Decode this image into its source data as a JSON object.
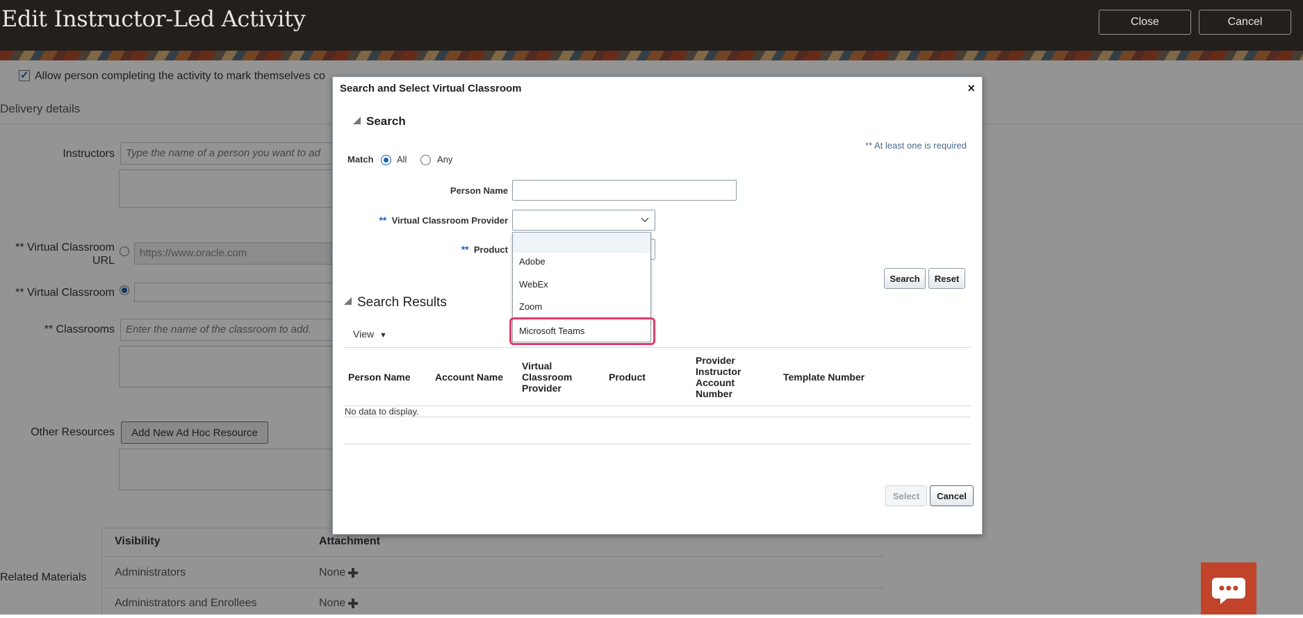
{
  "header": {
    "title": "Edit Instructor-Led Activity",
    "close_label": "Close",
    "cancel_label": "Cancel"
  },
  "page": {
    "allow_mark_complete_label": "Allow person completing the activity to mark themselves co",
    "allow_mark_complete_checked": true,
    "delivery_details_heading": "Delivery details",
    "instructors_label": "Instructors",
    "instructors_placeholder": "Type the name of a person you want to ad",
    "virtual_classroom_url_label_line1": "** Virtual Classroom",
    "virtual_classroom_url_label_line2": "URL",
    "virtual_classroom_url_placeholder": "https://www.oracle.com",
    "virtual_classroom_label": "** Virtual Classroom",
    "classrooms_label": "** Classrooms",
    "classrooms_placeholder": "Enter the name of the classroom to add.",
    "other_resources_label": "Other Resources",
    "add_ad_hoc_resource_label": "Add New Ad Hoc Resource",
    "related_materials_label": "Related Materials",
    "materials_table": {
      "headers": [
        "Visibility",
        "Attachment"
      ],
      "rows": [
        {
          "visibility": "Administrators",
          "attachment": "None"
        },
        {
          "visibility": "Administrators and Enrollees",
          "attachment": "None"
        }
      ]
    }
  },
  "dialog": {
    "title": "Search and Select Virtual Classroom",
    "close_symbol": "×",
    "search_heading": "Search",
    "required_note": "** At least one is required",
    "match_label": "Match",
    "match_options": [
      "All",
      "Any"
    ],
    "match_selected": "All",
    "person_name_label": "Person Name",
    "person_name_value": "",
    "provider_required_marker": "**",
    "provider_label": "Virtual Classroom Provider",
    "provider_value": "",
    "product_required_marker": "**",
    "product_label": "Product",
    "provider_options": [
      "",
      "Adobe",
      "WebEx",
      "Zoom",
      "Microsoft Teams"
    ],
    "provider_highlighted_option": "Microsoft Teams",
    "search_button": "Search",
    "reset_button": "Reset",
    "results_heading": "Search Results",
    "view_menu": "View",
    "results_columns": [
      "Person Name",
      "Account Name",
      "Virtual Classroom Provider",
      "Product",
      "Provider Instructor Account Number",
      "Template Number"
    ],
    "no_data_text": "No data to display.",
    "select_button": "Select",
    "cancel_button": "Cancel"
  },
  "colors": {
    "header_bg": "#231f1c",
    "accent_blue": "#1b5fb8",
    "highlight_pink": "#e83a6a",
    "chat_bg": "#c0432a"
  }
}
